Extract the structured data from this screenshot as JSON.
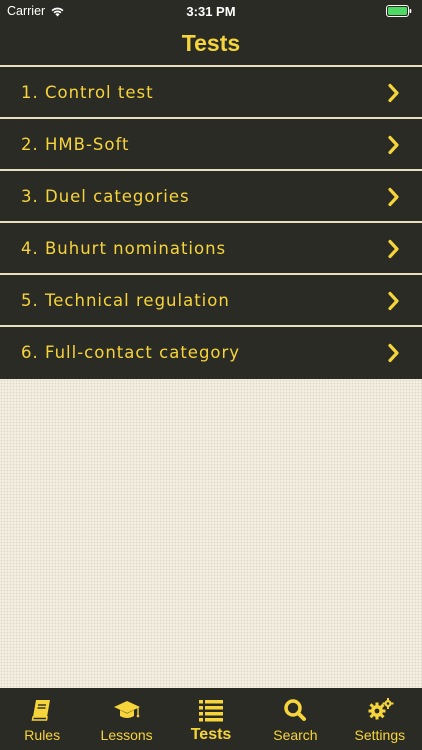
{
  "status_bar": {
    "carrier": "Carrier",
    "time": "3:31 PM"
  },
  "nav": {
    "title": "Tests"
  },
  "tests": [
    {
      "label": "1. Control test"
    },
    {
      "label": "2. HMB-Soft"
    },
    {
      "label": "3. Duel categories"
    },
    {
      "label": "4. Buhurt nominations"
    },
    {
      "label": "5. Technical regulation"
    },
    {
      "label": "6. Full-contact category"
    }
  ],
  "tab_bar": {
    "tabs": [
      {
        "label": "Rules",
        "icon": "book-icon"
      },
      {
        "label": "Lessons",
        "icon": "graduation-cap-icon"
      },
      {
        "label": "Tests",
        "icon": "list-icon",
        "active": true
      },
      {
        "label": "Search",
        "icon": "search-icon"
      },
      {
        "label": "Settings",
        "icon": "gears-icon"
      }
    ]
  },
  "colors": {
    "background": "#2b2b25",
    "accent": "#f6d43b",
    "divider": "#e9dfbd",
    "content": "#f1ebdc",
    "battery": "#4cd964"
  }
}
